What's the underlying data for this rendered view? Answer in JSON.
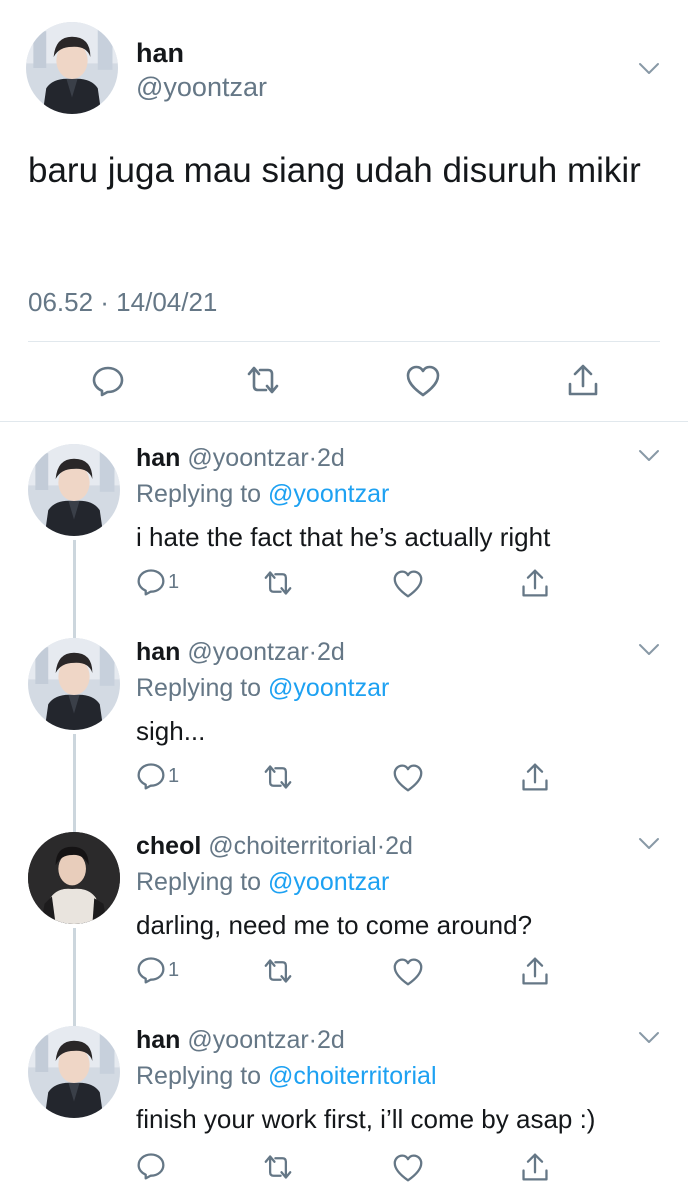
{
  "main_tweet": {
    "name": "han",
    "handle": "@yoontzar",
    "text": "baru juga mau siang udah disuruh mikir",
    "meta": "06.52 · 14/04/21",
    "avatar_icon": "profile-photo"
  },
  "icons": {
    "reply": "reply-icon",
    "retweet": "retweet-icon",
    "like": "like-icon",
    "share": "share-icon",
    "more": "chevron-down-icon"
  },
  "colors": {
    "text": "#14171a",
    "secondary": "#657786",
    "link": "#1da1f2",
    "divider": "#e1e8ed",
    "thread_line": "#ccd6dd"
  },
  "replies": [
    {
      "name": "han",
      "handle": "@yoontzar",
      "sep": "·",
      "time": "2d",
      "replying_prefix": "Replying to",
      "replying_to": "@yoontzar",
      "text": "i hate the fact that he’s actually right",
      "reply_count": "1"
    },
    {
      "name": "han",
      "handle": "@yoontzar",
      "sep": "·",
      "time": "2d",
      "replying_prefix": "Replying to",
      "replying_to": "@yoontzar",
      "text": "sigh...",
      "reply_count": "1"
    },
    {
      "name": "cheol",
      "handle": "@choiterritorial",
      "sep": "·",
      "time": "2d",
      "replying_prefix": "Replying to",
      "replying_to": "@yoontzar",
      "text": "darling, need me to come around?",
      "reply_count": "1"
    },
    {
      "name": "han",
      "handle": "@yoontzar",
      "sep": "·",
      "time": "2d",
      "replying_prefix": "Replying to",
      "replying_to": "@choiterritorial",
      "text": "finish your work first, i’ll come by asap :)",
      "reply_count": ""
    }
  ]
}
